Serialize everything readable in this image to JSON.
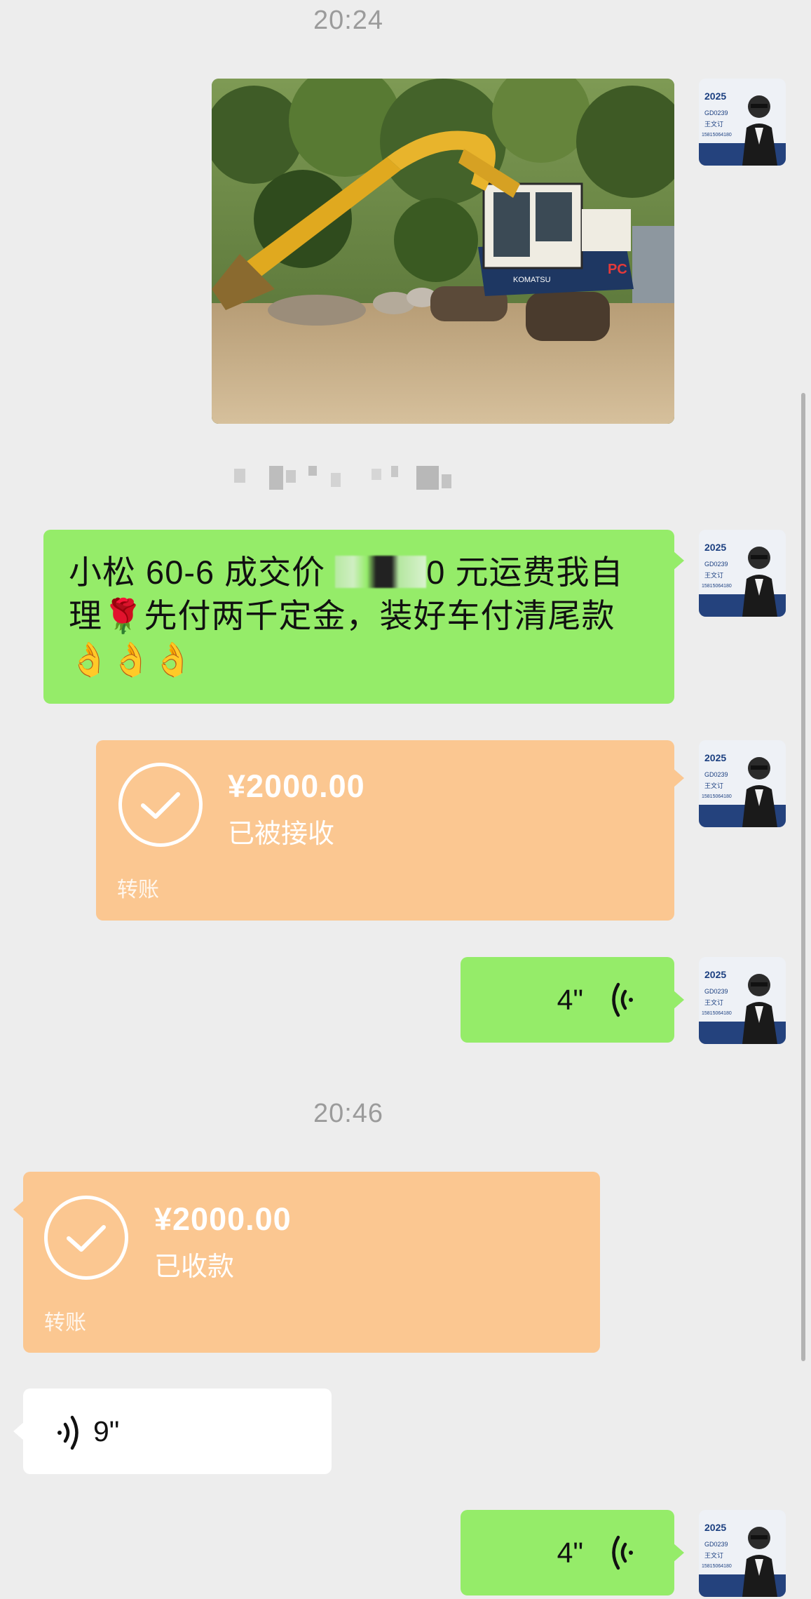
{
  "timestamps": [
    "20:24",
    "20:46"
  ],
  "messages": {
    "text": {
      "before_redaction": "小松 60-6 成交价 ",
      "after_redaction": "0 元运费我自理",
      "rose_emoji": "🌹",
      "rest": "先付两千定金，装好车付清尾款",
      "ok_emojis": "👌👌👌"
    },
    "transfer_sent": {
      "amount": "¥2000.00",
      "status": "已被接收",
      "kind": "转账"
    },
    "voice_sent_1": {
      "duration": "4\""
    },
    "transfer_received": {
      "amount": "¥2000.00",
      "status": "已收款",
      "kind": "转账"
    },
    "voice_received": {
      "duration": "9\""
    },
    "voice_sent_2": {
      "duration": "4\""
    }
  },
  "avatar_text": {
    "name": "王文订",
    "code": "GD0239",
    "phone": "15815064180"
  },
  "icons": {
    "check": "check-circle-icon",
    "voice_out": "voice-wave-right-icon",
    "voice_in": "voice-wave-left-icon"
  },
  "colors": {
    "background": "#ededed",
    "sent_bubble": "#95ec69",
    "received_bubble": "#ffffff",
    "transfer_bubble": "#fbc791",
    "timestamp": "#9b9b9b"
  }
}
